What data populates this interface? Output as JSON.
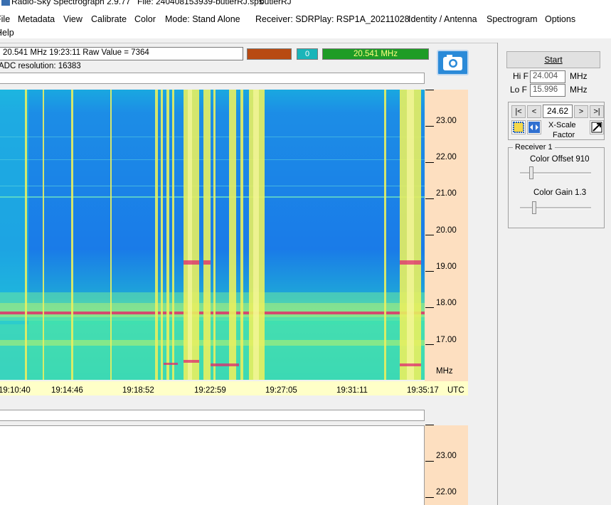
{
  "titlebar": {
    "app": "Radio-Sky Spectrograph 2.9.77",
    "file": "File: 240408153939-butlerRJ.sps",
    "user": "butlerRJ"
  },
  "menu": {
    "file": "File",
    "metadata": "Metadata",
    "view": "View",
    "calibrate": "Calibrate",
    "color": "Color",
    "mode": "Mode: Stand Alone",
    "receiver": "Receiver:  SDRPlay: RSP1A_20211028",
    "identity": "Identity / Antenna",
    "spectrogram": "Spectrogram",
    "options": "Options",
    "help": "Help"
  },
  "readout": {
    "cursor": "20.541 MHz  19:23:11  Raw Value =  7364",
    "adc": "ADC resolution:  16383",
    "counter": "0",
    "freq": "20.541 MHz",
    "swatch_color": "#b84a12"
  },
  "plot": {
    "y_ticks": [
      "23.00",
      "22.00",
      "21.00",
      "20.00",
      "19.00",
      "18.00",
      "17.00"
    ],
    "y_unit": "MHz",
    "x_ticks": [
      "19:10:40",
      "19:14:46",
      "19:18:52",
      "19:22:59",
      "19:27:05",
      "19:31:11",
      "19:35:17"
    ],
    "x_unit": "UTC",
    "lower_y_ticks": [
      "23.00",
      "22.00"
    ]
  },
  "controls": {
    "start": "Start",
    "hi_f_label": "Hi F",
    "hi_f": "24.004",
    "lo_f_label": "Lo F",
    "lo_f": "15.996",
    "mhz": "MHz",
    "xscale_value": "24.62",
    "first": "|<",
    "prev": "<",
    "next": ">",
    "last": ">|",
    "xscale_label1": "X-Scale",
    "xscale_label2": "Factor",
    "receiver_group": "Receiver 1",
    "color_offset": "Color Offset 910",
    "color_gain": "Color Gain 1.3"
  }
}
